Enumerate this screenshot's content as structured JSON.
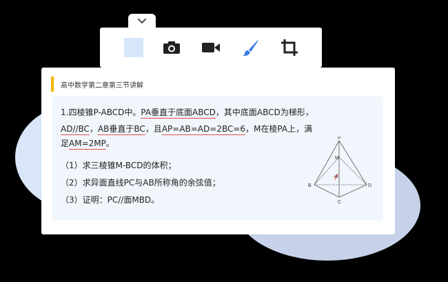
{
  "toolbar": {
    "handle_icon": "chevron-down-icon",
    "tools": [
      {
        "name": "color-swatch",
        "color": "#d6e6fb"
      },
      {
        "name": "camera-icon"
      },
      {
        "name": "video-icon"
      },
      {
        "name": "brush-icon",
        "color": "#3b7de6"
      },
      {
        "name": "crop-icon"
      }
    ]
  },
  "card": {
    "title": "高中数学第二章第三节讲解",
    "accent_color": "#f5b400",
    "problem": {
      "l1_a": "1.四棱锥P-ABCD中。",
      "l1_b": "PA垂直于底面ABCD",
      "l1_c": "，其中底面ABCD为梯形，",
      "l2_a": "AD//BC",
      "l2_b": "，",
      "l2_c": "AB垂直于BC",
      "l2_d": "，且",
      "l2_e": "AP=AB=AD=2BC=6",
      "l2_f": "，M在棱PA上，满",
      "l3_a": "足",
      "l3_b": "AM=2MP",
      "l3_c": "。"
    },
    "questions": [
      "（1）求三棱锥M-BCD的体积；",
      "（2）求异面直线PC与AB所称角的余弦值；",
      "（3）证明：PC//面MBD。"
    ],
    "figure_labels": {
      "P": "P",
      "M": "M",
      "A": "A",
      "B": "B",
      "C": "C",
      "D": "D"
    }
  }
}
